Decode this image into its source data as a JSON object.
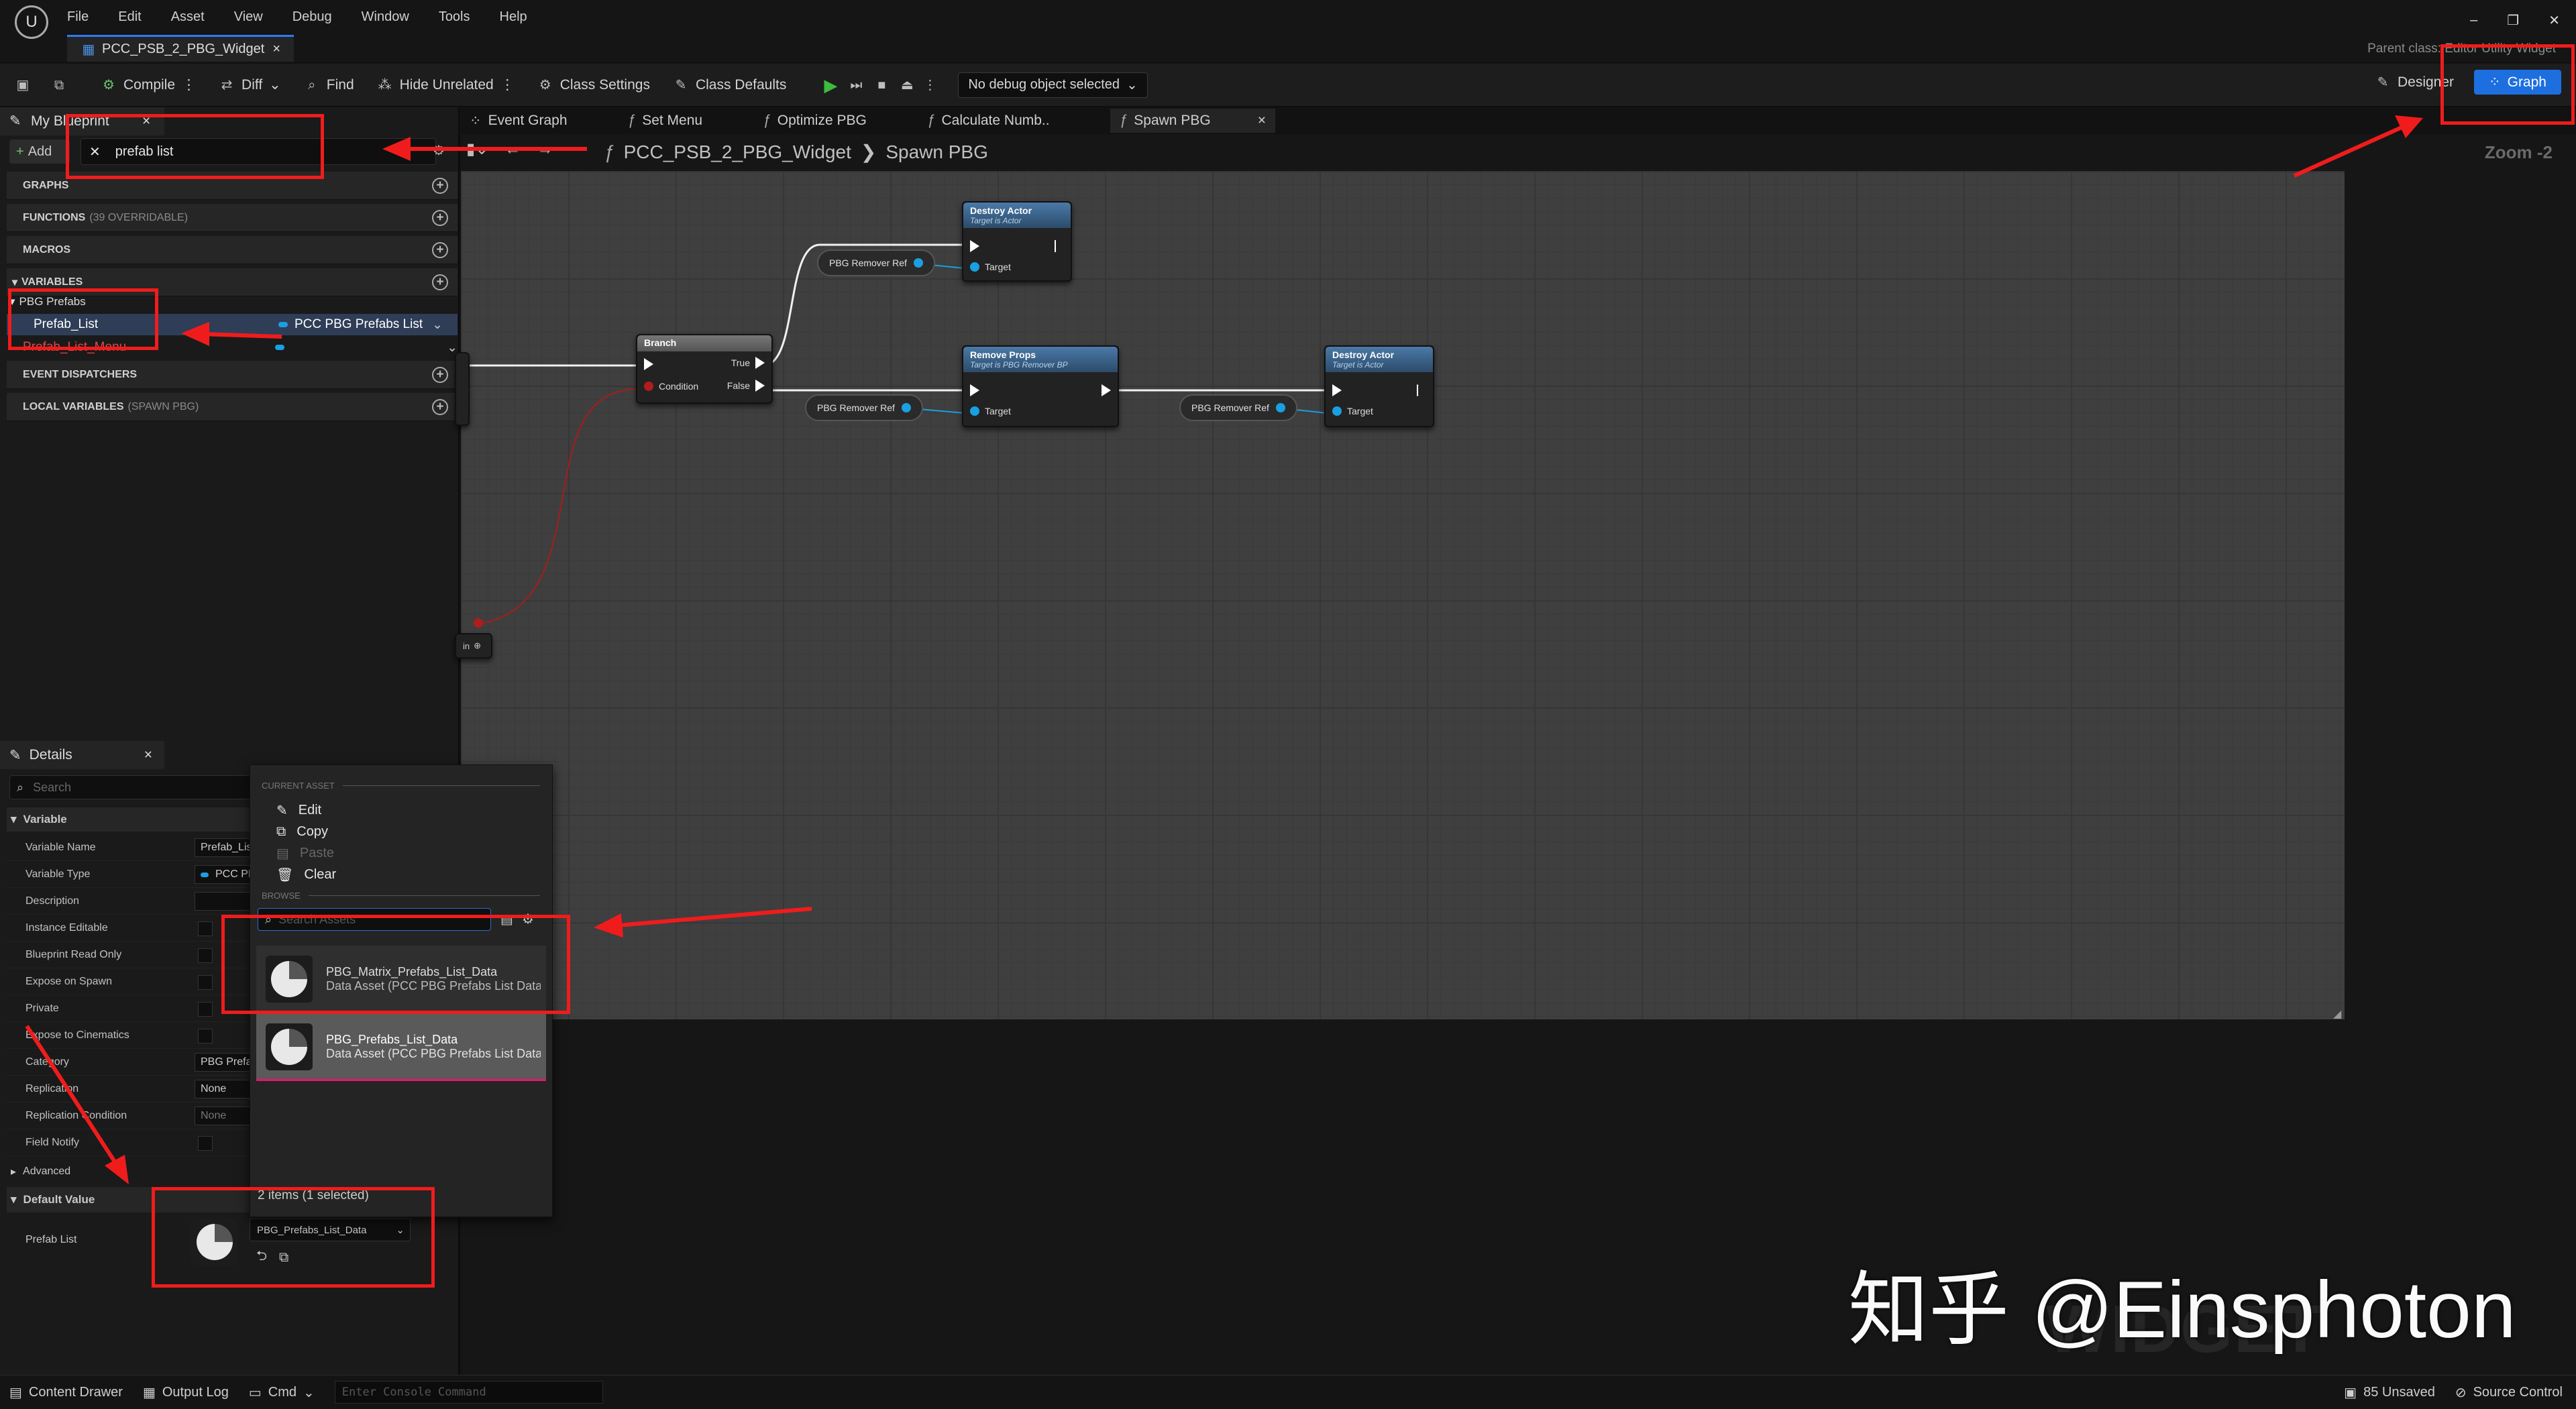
{
  "menu": [
    "File",
    "Edit",
    "Asset",
    "View",
    "Debug",
    "Window",
    "Tools",
    "Help"
  ],
  "window_controls": {
    "minimize": "–",
    "restore": "❐",
    "close": "✕"
  },
  "parent_class": "Parent class: Editor Utility Widget",
  "doc_tab": {
    "title": "PCC_PSB_2_PBG_Widget",
    "close": "×"
  },
  "toolbar": {
    "compile": "Compile",
    "diff": "Diff",
    "find": "Find",
    "hide_unrelated": "Hide Unrelated",
    "class_settings": "Class Settings",
    "class_defaults": "Class Defaults",
    "debug_select": "No debug object selected",
    "designer": "Designer",
    "graph": "Graph"
  },
  "my_blueprint": {
    "tab": "My Blueprint",
    "tab_close": "×",
    "add": "Add",
    "search_value": "prefab list",
    "sections": {
      "graphs": "GRAPHS",
      "functions": "FUNCTIONS",
      "functions_note": "(39 OVERRIDABLE)",
      "macros": "MACROS",
      "variables": "VARIABLES",
      "event_dispatchers": "EVENT DISPATCHERS",
      "local_variables": "LOCAL VARIABLES",
      "local_note": "(SPAWN PBG)"
    },
    "category": "PBG Prefabs",
    "vars": [
      {
        "name": "Prefab_List",
        "type": "PCC PBG Prefabs List"
      },
      {
        "name": "Prefab_List_Menu",
        "type": ""
      }
    ]
  },
  "graph_tabs": [
    "Event Graph",
    "Set Menu",
    "Optimize PBG",
    "Calculate Numb..",
    "Spawn PBG"
  ],
  "graph_tab_close": "×",
  "breadcrumb": {
    "root": "PCC_PSB_2_PBG_Widget",
    "current": "Spawn PBG",
    "sep": "❯"
  },
  "zoom": "Zoom -2",
  "nodes": {
    "branch": {
      "title": "Branch",
      "true": "True",
      "false": "False",
      "condition": "Condition"
    },
    "destroy1": {
      "title": "Destroy Actor",
      "subtitle": "Target is Actor",
      "target": "Target"
    },
    "remove": {
      "title": "Remove Props",
      "subtitle": "Target is PBG Remover BP",
      "target": "Target"
    },
    "destroy2": {
      "title": "Destroy Actor",
      "subtitle": "Target is Actor",
      "target": "Target"
    },
    "ref_label": "PBG Remover Ref",
    "stub_label": "in"
  },
  "details": {
    "tab": "Details",
    "close": "×",
    "search_placeholder": "Search",
    "variable_section": "Variable",
    "rows": [
      {
        "label": "Variable Name",
        "value": "Prefab_List"
      },
      {
        "label": "Variable Type",
        "value": "PCC PBG Prefabs List"
      },
      {
        "label": "Description",
        "value": ""
      },
      {
        "label": "Instance Editable",
        "value": ""
      },
      {
        "label": "Blueprint Read Only",
        "value": ""
      },
      {
        "label": "Expose on Spawn",
        "value": ""
      },
      {
        "label": "Private",
        "value": ""
      },
      {
        "label": "Expose to Cinematics",
        "value": ""
      },
      {
        "label": "Category",
        "value": "PBG Prefabs"
      },
      {
        "label": "Replication",
        "value": "None"
      },
      {
        "label": "Replication Condition",
        "value": "None"
      },
      {
        "label": "Field Notify",
        "value": ""
      }
    ],
    "advanced": "Advanced",
    "default_section": "Default Value",
    "prefab_label": "Prefab List",
    "prefab_value": "PBG_Prefabs_List_Data"
  },
  "popup": {
    "current_asset": "CURRENT ASSET",
    "edit": "Edit",
    "copy": "Copy",
    "paste": "Paste",
    "clear": "Clear",
    "browse": "BROWSE",
    "search_placeholder": "Search Assets",
    "assets": [
      {
        "name": "PBG_Matrix_Prefabs_List_Data",
        "type": "Data Asset (PCC PBG Prefabs List Data)"
      },
      {
        "name": "PBG_Prefabs_List_Data",
        "type": "Data Asset (PCC PBG Prefabs List Data)"
      }
    ],
    "count": "2 items (1 selected)"
  },
  "watermark": "WIDGET BLUEPRINT",
  "overlay_text": "知乎 @Einsphoton",
  "statusbar": {
    "content_drawer": "Content Drawer",
    "output_log": "Output Log",
    "cmd": "Cmd",
    "console_placeholder": "Enter Console Command",
    "unsaved": "85 Unsaved",
    "source_control": "Source Control"
  },
  "colors": {
    "accent": "#1d6fe0",
    "annotation": "#f01c1c",
    "node_header": "#3a6590",
    "data_pin": "#1a9fe3",
    "bool_pin": "#b11c1c"
  }
}
